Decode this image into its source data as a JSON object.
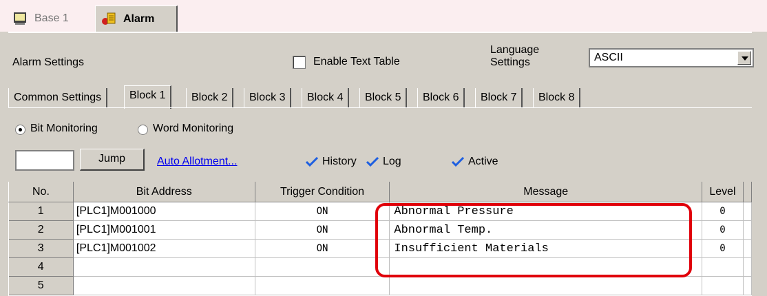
{
  "doc_tabs": [
    {
      "label": "Base 1",
      "icon": "monitor-icon"
    },
    {
      "label": "Alarm",
      "icon": "alarm-icon"
    }
  ],
  "settings": {
    "label": "Alarm Settings",
    "enable_text_table": {
      "label": "Enable Text Table",
      "checked": false
    },
    "language_label": "Language Settings",
    "language_value": "ASCII"
  },
  "block_tabs": [
    "Common Settings",
    "Block 1",
    "Block 2",
    "Block 3",
    "Block 4",
    "Block 5",
    "Block 6",
    "Block 7",
    "Block 8"
  ],
  "active_tab": "Block 1",
  "monitoring": {
    "bit": {
      "label": "Bit Monitoring",
      "selected": true
    },
    "word": {
      "label": "Word Monitoring",
      "selected": false
    }
  },
  "toolbar": {
    "jump_value": "",
    "jump_label": "Jump",
    "auto_allotment": "Auto Allotment...",
    "history": "History",
    "log": "Log",
    "active": "Active",
    "check_color": "#1e5fe0"
  },
  "table": {
    "headers": [
      "No.",
      "Bit Address",
      "Trigger Condition",
      "Message",
      "Level"
    ],
    "rows": [
      {
        "no": "1",
        "address": "[PLC1]M001000",
        "trigger": "ON",
        "message": "Abnormal Pressure",
        "level": "0"
      },
      {
        "no": "2",
        "address": "[PLC1]M001001",
        "trigger": "ON",
        "message": "Abnormal Temp.",
        "level": "0"
      },
      {
        "no": "3",
        "address": "[PLC1]M001002",
        "trigger": "ON",
        "message": "Insufficient Materials",
        "level": "0"
      },
      {
        "no": "4",
        "address": "",
        "trigger": "",
        "message": "",
        "level": ""
      },
      {
        "no": "5",
        "address": "",
        "trigger": "",
        "message": "",
        "level": ""
      }
    ]
  },
  "highlight_color": "#e0000a"
}
